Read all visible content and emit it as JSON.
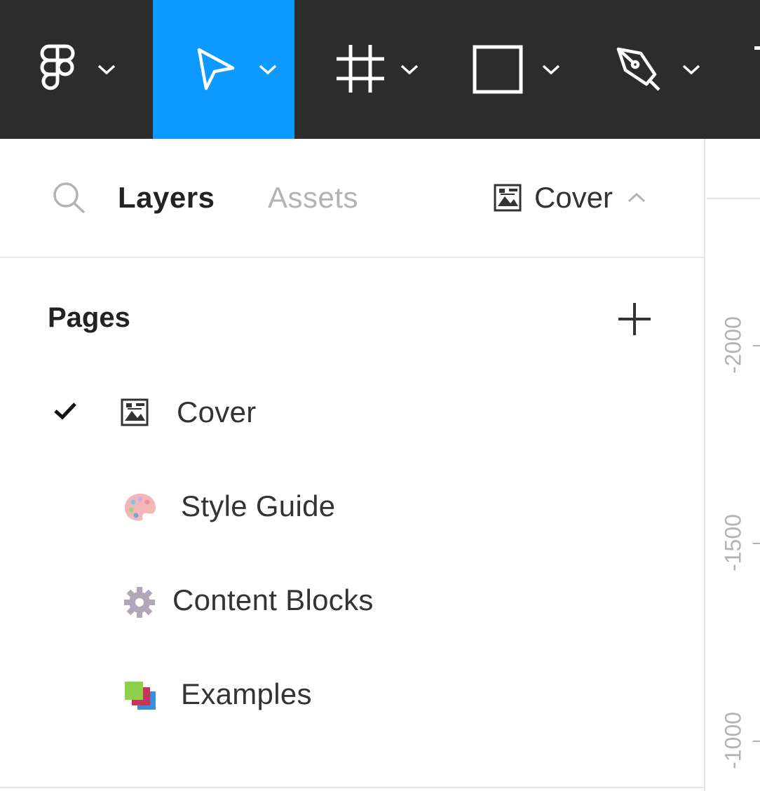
{
  "toolbar": {
    "tools": [
      {
        "name": "main-menu",
        "icon": "figma-logo-icon",
        "active": false
      },
      {
        "name": "move-tool",
        "icon": "move-arrow-icon",
        "active": true
      },
      {
        "name": "frame-tool",
        "icon": "frame-icon",
        "active": false
      },
      {
        "name": "shape-tool",
        "icon": "rectangle-icon",
        "active": false
      },
      {
        "name": "pen-tool",
        "icon": "pen-icon",
        "active": false
      }
    ],
    "active_color": "#0d99ff",
    "background_color": "#2c2c2c"
  },
  "panel": {
    "tabs": {
      "layers_label": "Layers",
      "assets_label": "Assets"
    },
    "current_page": {
      "label": "Cover",
      "icon": "cover-image-icon"
    },
    "pages": {
      "title": "Pages",
      "items": [
        {
          "label": "Cover",
          "icon": "cover-image-icon",
          "selected": true
        },
        {
          "label": "Style Guide",
          "icon": "palette-icon",
          "selected": false
        },
        {
          "label": "Content Blocks",
          "icon": "gear-icon",
          "selected": false
        },
        {
          "label": "Examples",
          "icon": "layered-squares-icon",
          "selected": false
        }
      ]
    }
  },
  "ruler": {
    "labels": [
      "-2000",
      "-1500",
      "-1000"
    ]
  }
}
